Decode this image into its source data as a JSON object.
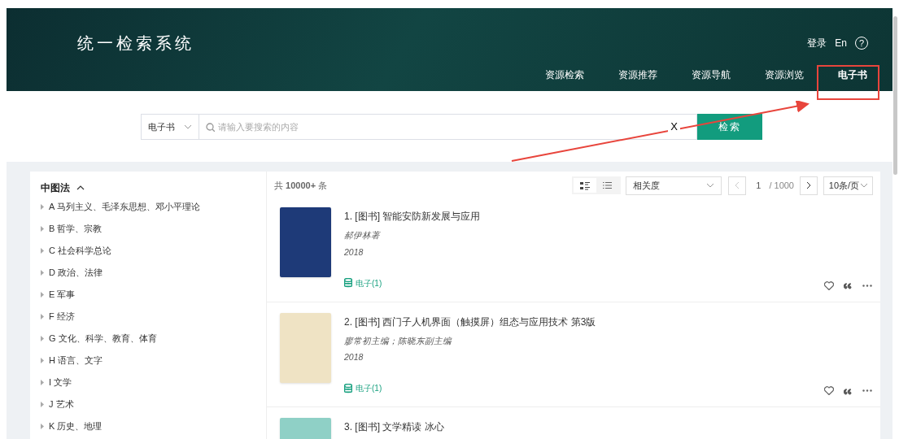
{
  "header": {
    "title": "统一检索系统",
    "links": [
      {
        "kind": "text",
        "label": "登录"
      },
      {
        "kind": "text",
        "label": "En"
      },
      {
        "kind": "help",
        "label": "?"
      }
    ],
    "nav": [
      {
        "label": "资源检索",
        "selected": false
      },
      {
        "label": "资源推荐",
        "selected": false
      },
      {
        "label": "资源导航",
        "selected": false
      },
      {
        "label": "资源浏览",
        "selected": false
      },
      {
        "label": "电子书",
        "selected": true
      }
    ]
  },
  "search": {
    "scope": "电子书",
    "placeholder": "请输入要搜索的内容",
    "clear": "X",
    "button": "检索"
  },
  "sidebar": {
    "title": "中图法",
    "expanded": true,
    "items": [
      {
        "label": "A 马列主义、毛泽东思想、邓小平理论"
      },
      {
        "label": "B 哲学、宗教"
      },
      {
        "label": "C 社会科学总论"
      },
      {
        "label": "D 政治、法律"
      },
      {
        "label": "E 军事"
      },
      {
        "label": "F 经济"
      },
      {
        "label": "G 文化、科学、教育、体育"
      },
      {
        "label": "H 语言、文字"
      },
      {
        "label": "I 文学"
      },
      {
        "label": "J 艺术"
      },
      {
        "label": "K 历史、地理"
      }
    ]
  },
  "results": {
    "count": "共 **10000+** 条",
    "views": [
      {
        "kind": "detail",
        "selected": true
      },
      {
        "kind": "list",
        "selected": false
      }
    ],
    "sort": "相关度",
    "page": "1",
    "total_pages": "/ 1000",
    "page_size": "10条/页",
    "prev_disabled": true,
    "items": [
      {
        "title": "1. [图书] 智能安防新发展与应用",
        "author": "郝伊林著",
        "year": "2018",
        "holding": "电子(1)"
      },
      {
        "title": "2. [图书] 西门子人机界面（触摸屏）组态与应用技术 第3版",
        "author": "廖常初主编；陈晓东副主编",
        "year": "2018",
        "holding": "电子(1)"
      },
      {
        "title": "3. [图书] 文学精读 冰心"
      }
    ]
  }
}
